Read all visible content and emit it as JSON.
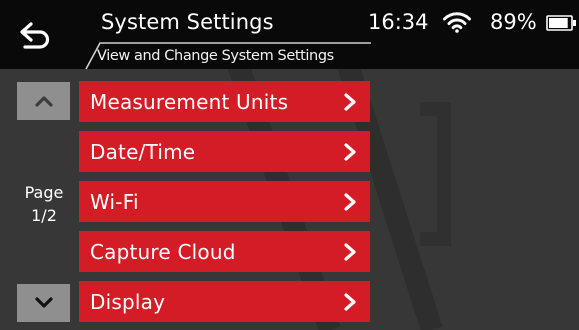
{
  "header": {
    "title": "System Settings",
    "subtitle": "View and Change System Settings",
    "back_icon": "back-arrow-icon"
  },
  "status": {
    "time": "16:34",
    "wifi_icon": "wifi-icon",
    "battery_percent": "89%",
    "battery_icon": "battery-icon",
    "battery_level": 0.89
  },
  "pager": {
    "label_line1": "Page",
    "label_line2": "1/2",
    "up_icon": "chevron-up-icon",
    "down_icon": "chevron-down-icon"
  },
  "menu": {
    "items": [
      {
        "label": "Measurement Units"
      },
      {
        "label": "Date/Time"
      },
      {
        "label": "Wi-Fi"
      },
      {
        "label": "Capture Cloud"
      },
      {
        "label": "Display"
      }
    ],
    "chevron_icon": "chevron-right-icon"
  },
  "colors": {
    "header_bg": "#090909",
    "body_bg": "#373737",
    "menu_item_bg": "#d41c27",
    "pager_button_bg": "#8f8f8f",
    "text": "#ffffff"
  }
}
